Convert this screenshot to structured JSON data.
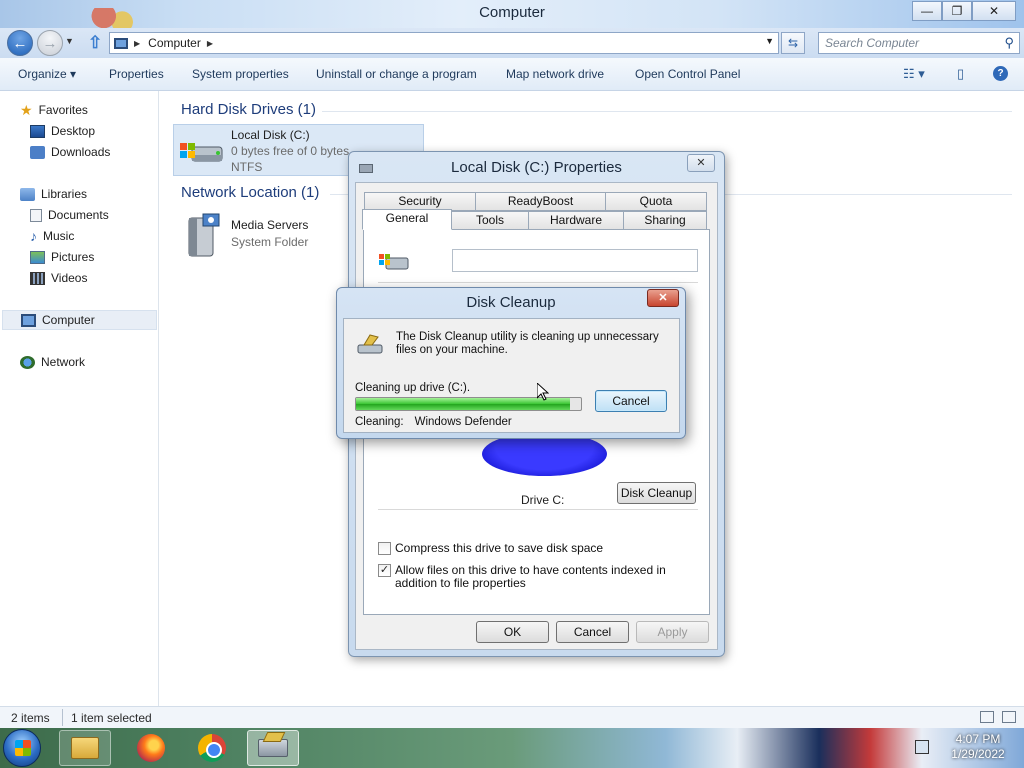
{
  "window": {
    "title": "Computer",
    "minimize": "—",
    "maximize": "❐",
    "close": "✕"
  },
  "address": {
    "crumb": "Computer",
    "search_placeholder": "Search Computer"
  },
  "commands": [
    "Organize ▾",
    "Properties",
    "System properties",
    "Uninstall or change a program",
    "Map network drive",
    "Open Control Panel"
  ],
  "navpane": {
    "favorites": "Favorites",
    "desktop": "Desktop",
    "downloads": "Downloads",
    "libraries": "Libraries",
    "documents": "Documents",
    "music": "Music",
    "pictures": "Pictures",
    "videos": "Videos",
    "computer": "Computer",
    "network": "Network"
  },
  "content": {
    "hdd_group": "Hard Disk Drives (1)",
    "net_group": "Network Location (1)",
    "drive": {
      "name": "Local Disk (C:)",
      "free": "0 bytes free of 0 bytes",
      "fs": "NTFS"
    },
    "server": {
      "name": "Media Servers",
      "type": "System Folder"
    }
  },
  "status": {
    "items": "2 items",
    "selected": "1 item selected"
  },
  "taskbar": {
    "time": "4:07 PM",
    "date": "1/29/2022"
  },
  "properties": {
    "title": "Local Disk (C:) Properties",
    "close": "✕",
    "tabs_row1": [
      "Security",
      "ReadyBoost",
      "Quota"
    ],
    "tabs_row2": [
      "General",
      "Tools",
      "Hardware",
      "Sharing"
    ],
    "drive_label": "Drive C:",
    "disk_cleanup_btn": "Disk Cleanup",
    "compress": "Compress this drive to save disk space",
    "compress_checked": false,
    "index": "Allow files on this drive to have contents indexed in addition to file properties",
    "index_checked": true,
    "ok": "OK",
    "cancel": "Cancel",
    "apply": "Apply"
  },
  "cleanup": {
    "title": "Disk Cleanup",
    "close": "✕",
    "message": "The Disk Cleanup utility is cleaning up unnecessary files on your machine.",
    "drive_text": "Cleaning up drive  (C:).",
    "progress_percent": 95,
    "cancel": "Cancel",
    "status_label": "Cleaning:",
    "status_value": "Windows Defender"
  }
}
